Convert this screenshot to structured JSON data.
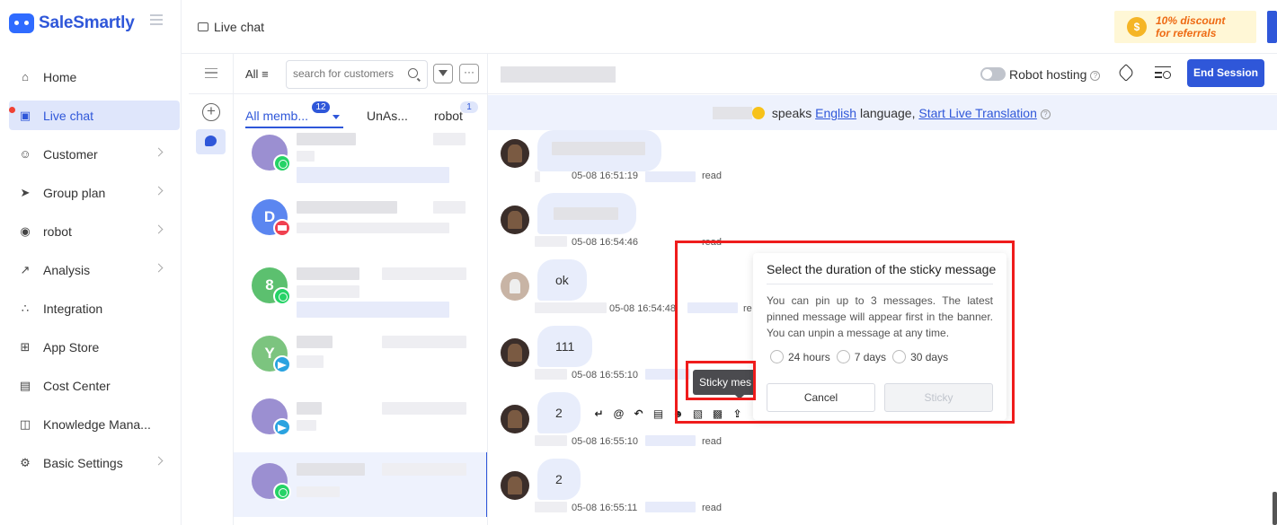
{
  "brand": {
    "name": "SaleSmartly"
  },
  "sidebar": {
    "items": [
      {
        "label": "Home",
        "icon": "home-icon",
        "arrow": false,
        "active": false
      },
      {
        "label": "Live chat",
        "icon": "chat-icon",
        "arrow": false,
        "active": true
      },
      {
        "label": "Customer",
        "icon": "customer-icon",
        "arrow": true,
        "active": false
      },
      {
        "label": "Group plan",
        "icon": "send-icon",
        "arrow": true,
        "active": false
      },
      {
        "label": "robot",
        "icon": "robot-icon",
        "arrow": true,
        "active": false
      },
      {
        "label": "Analysis",
        "icon": "analysis-icon",
        "arrow": true,
        "active": false
      },
      {
        "label": "Integration",
        "icon": "integration-icon",
        "arrow": false,
        "active": false
      },
      {
        "label": "App Store",
        "icon": "app-store-icon",
        "arrow": false,
        "active": false
      },
      {
        "label": "Cost Center",
        "icon": "wallet-icon",
        "arrow": false,
        "active": false
      },
      {
        "label": "Knowledge Mana...",
        "icon": "book-icon",
        "arrow": false,
        "active": false
      },
      {
        "label": "Basic Settings",
        "icon": "settings-icon",
        "arrow": true,
        "active": false
      }
    ]
  },
  "topbar": {
    "tab_title": "Live chat",
    "promo_line1": "10% discount",
    "promo_line2": "for referrals"
  },
  "conversation_list": {
    "all_label": "All",
    "search_placeholder": "search for customers",
    "more_label": "···",
    "tabs": [
      {
        "label": "All memb...",
        "badge": "12"
      },
      {
        "label": "UnAs...",
        "badge": ""
      },
      {
        "label": "robot",
        "badge": "1"
      }
    ],
    "items": [
      {
        "initial": "",
        "channel": "whatsapp",
        "avatar_color": "#9b8fd1"
      },
      {
        "initial": "D",
        "channel": "email",
        "avatar_color": "#5b86f0"
      },
      {
        "initial": "8",
        "channel": "whatsapp",
        "avatar_color": "#5cc06f"
      },
      {
        "initial": "Y",
        "channel": "telegram",
        "avatar_color": "#7cc47f"
      },
      {
        "initial": "",
        "channel": "telegram",
        "avatar_color": "#9b8fd1"
      },
      {
        "initial": "",
        "channel": "whatsapp",
        "avatar_color": "#9b8fd1"
      }
    ]
  },
  "chat": {
    "robot_hosting_label": "Robot hosting",
    "end_session_label": "End Session",
    "language_bar": {
      "speaks": "speaks",
      "language": "English",
      "suffix": "language,",
      "translate_link": "Start Live Translation"
    },
    "messages": [
      {
        "text": "",
        "time": "05-08 16:51:19",
        "status": "read"
      },
      {
        "text": "",
        "time": "05-08 16:54:46",
        "status": "read"
      },
      {
        "text": "ok",
        "time": "05-08 16:54:48",
        "status": "re"
      },
      {
        "text": "111",
        "time": "05-08 16:55:10",
        "status": ""
      },
      {
        "text": "2",
        "time": "05-08 16:55:10",
        "status": "read"
      },
      {
        "text": "2",
        "time": "05-08 16:55:11",
        "status": "read"
      }
    ],
    "tooltip": "Sticky mes"
  },
  "sticky_popover": {
    "title": "Select the duration of the sticky message",
    "description": "You can pin up to 3 messages. The latest pinned message will appear first in the banner. You can unpin a message at any time.",
    "options": [
      "24 hours",
      "7 days",
      "30 days"
    ],
    "cancel_label": "Cancel",
    "confirm_label": "Sticky"
  }
}
